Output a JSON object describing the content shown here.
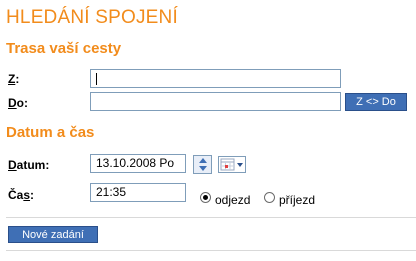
{
  "page": {
    "title": "HLEDÁNÍ SPOJENÍ"
  },
  "route": {
    "heading": "Trasa vaší cesty",
    "from_label_key": "Z",
    "from_label_rest": ":",
    "from_value": "",
    "to_label_key": "D",
    "to_label_rest": "o:",
    "to_value": "",
    "swap_button": "Z <> Do"
  },
  "datetime": {
    "heading": "Datum a čas",
    "date_label_key": "D",
    "date_label_rest": "atum:",
    "date_value": "13.10.2008 Po",
    "time_label_pre": "Ča",
    "time_label_key": "s",
    "time_label_rest": ":",
    "time_value": "21:35",
    "departure_label": "odjezd",
    "arrival_label": "příjezd",
    "selected": "odjezd"
  },
  "actions": {
    "reset_button": "Nové zadání"
  },
  "colors": {
    "accent": "#f28c1c",
    "button": "#3f6fb5"
  },
  "icons": {
    "spinner": "up-down-spinner-icon",
    "calendar": "calendar-dropdown-icon"
  }
}
